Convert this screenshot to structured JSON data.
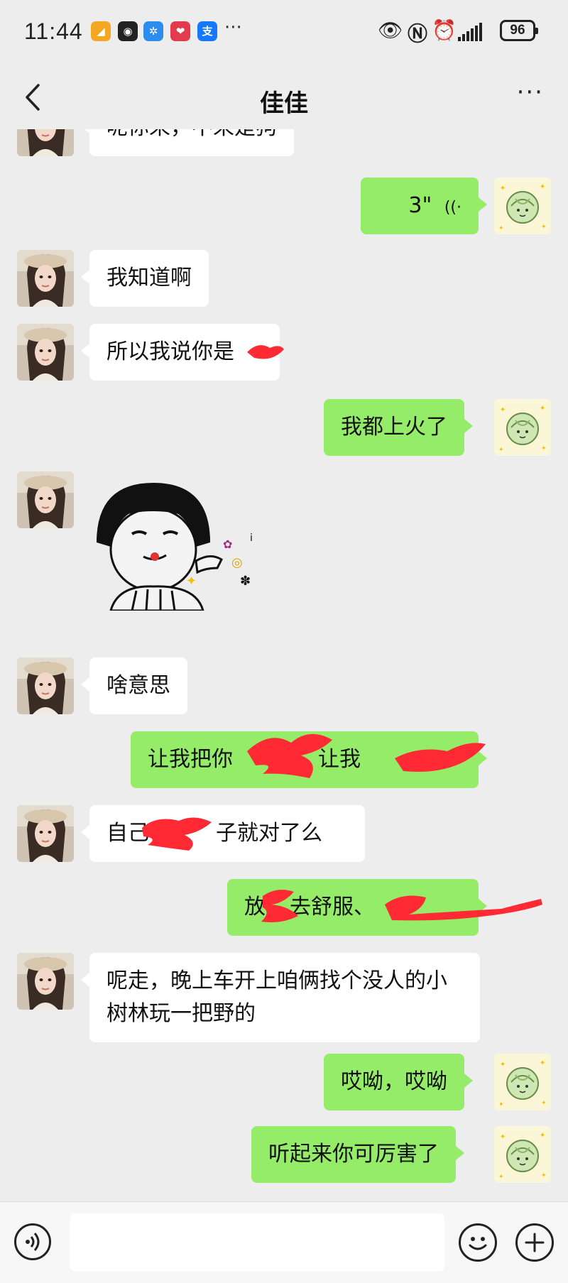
{
  "status_bar": {
    "time": "11:44",
    "app_icons": [
      {
        "name": "app-icon-orange",
        "color": "#f5a623",
        "glyph": "◢"
      },
      {
        "name": "app-icon-black",
        "color": "#222222",
        "glyph": "◉"
      },
      {
        "name": "app-icon-blue",
        "color": "#2d8cf0",
        "glyph": "✲"
      },
      {
        "name": "app-icon-red",
        "color": "#e23b4b",
        "glyph": "❤"
      },
      {
        "name": "app-icon-alipay",
        "color": "#1677ff",
        "glyph": "支"
      }
    ],
    "overflow": "···",
    "battery": "96"
  },
  "nav": {
    "title": "佳佳",
    "more": "···"
  },
  "messages": [
    {
      "side": "left",
      "type": "text",
      "text": "呢你来，不来是狗"
    },
    {
      "side": "right",
      "type": "voice",
      "duration": "3\""
    },
    {
      "side": "left",
      "type": "text",
      "text": "我知道啊"
    },
    {
      "side": "left",
      "type": "text",
      "text": "所以我说你是"
    },
    {
      "side": "right",
      "type": "text",
      "text": "我都上火了"
    },
    {
      "side": "left",
      "type": "sticker",
      "sticker": "mushroom-head-meme-sticker"
    },
    {
      "side": "left",
      "type": "text",
      "text": "啥意思"
    },
    {
      "side": "right",
      "type": "text",
      "text": "让我把你",
      "text2": "，让我"
    },
    {
      "side": "left",
      "type": "text",
      "text": "自己",
      "text2": "子就对了么"
    },
    {
      "side": "right",
      "type": "text",
      "text": "放",
      "text2": "去舒服、"
    },
    {
      "side": "left",
      "type": "text",
      "text": "呢走，晚上车开上咱俩找个没人的小树林玩一把野的"
    },
    {
      "side": "right",
      "type": "text",
      "text": "哎呦，哎呦"
    },
    {
      "side": "right",
      "type": "text",
      "text": "听起来你可厉害了"
    }
  ],
  "input": {
    "placeholder": "",
    "value": ""
  },
  "colors": {
    "bg": "#ededed",
    "bubble_self": "#95ec69",
    "bubble_other": "#ffffff",
    "scribble": "#ff1f2a"
  }
}
